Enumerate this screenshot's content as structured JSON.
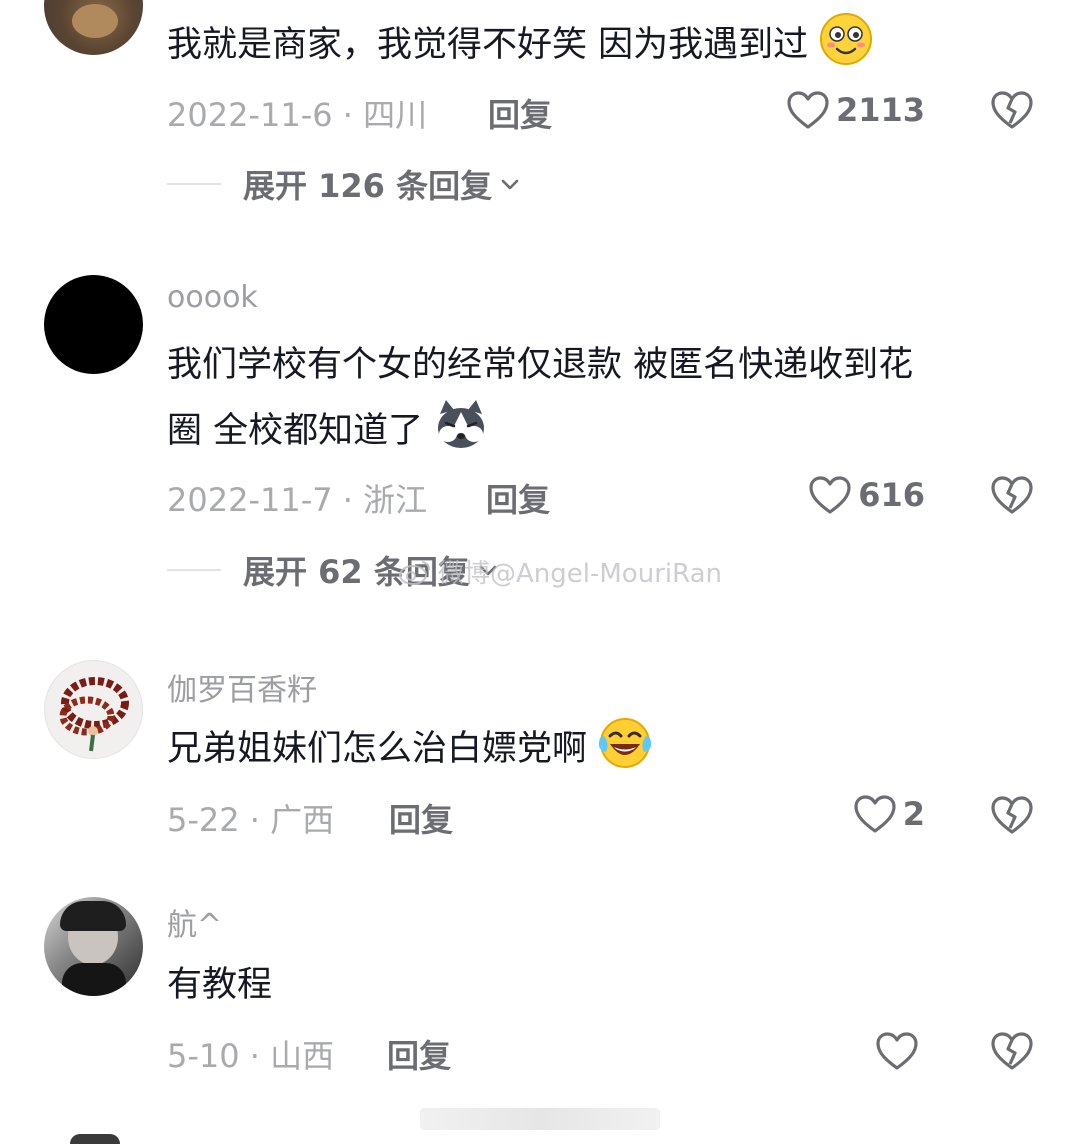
{
  "comments": [
    {
      "text": "我就是商家，我觉得不好笑 因为我遇到过",
      "emoji": "smiling-face-emoji",
      "date_location": "2022-11-6 · 四川",
      "reply_label": "回复",
      "like_count": "2113",
      "expand_label": "展开 126 条回复"
    },
    {
      "username": "ooook",
      "text_line1": "我们学校有个女的经常仅退款 被匿名快递收到花",
      "text_line2": "圈 全校都知道了",
      "emoji": "husky-dog-emoji",
      "date_location": "2022-11-7 · 浙江",
      "reply_label": "回复",
      "like_count": "616",
      "expand_label": "展开 62 条回复"
    },
    {
      "username": "伽罗百香籽",
      "text": "兄弟姐妹们怎么治白嫖党啊",
      "emoji": "laughing-tears-emoji",
      "date_location": "5-22 · 广西",
      "reply_label": "回复",
      "like_count": "2"
    },
    {
      "username": "航^",
      "text": "有教程",
      "date_location": "5-10 · 山西",
      "reply_label": "回复",
      "like_count": ""
    }
  ],
  "watermark": "微博@Angel-MouriRan",
  "colors": {
    "text_primary": "#161823",
    "text_secondary": "#9d9ea3",
    "icon_gray": "#6c6d72"
  }
}
